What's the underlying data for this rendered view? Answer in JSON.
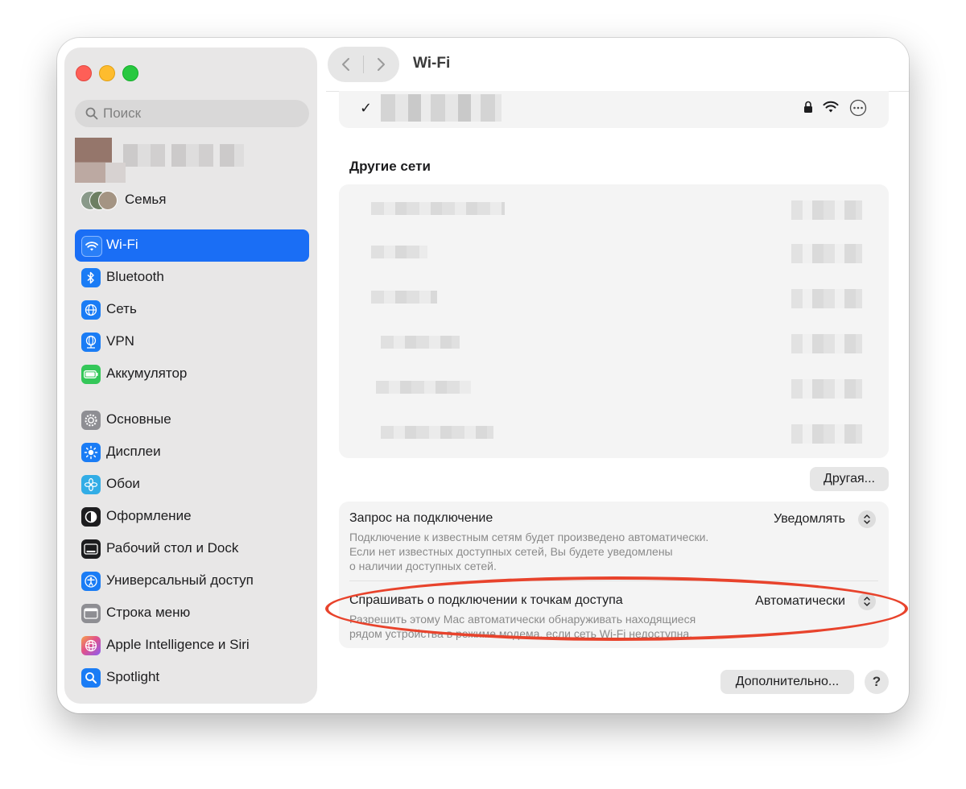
{
  "window": {
    "title": "Wi-Fi"
  },
  "search": {
    "placeholder": "Поиск"
  },
  "account": {
    "family_label": "Семья"
  },
  "sidebar": {
    "items": [
      {
        "label": "Wi-Fi",
        "icon": "wifi-icon",
        "color": "#1a6ef5",
        "active": true
      },
      {
        "label": "Bluetooth",
        "icon": "bluetooth-icon",
        "color": "#1a7cf5"
      },
      {
        "label": "Сеть",
        "icon": "globe-icon",
        "color": "#1a7cf5"
      },
      {
        "label": "VPN",
        "icon": "vpn-globe-icon",
        "color": "#1a7cf5"
      },
      {
        "label": "Аккумулятор",
        "icon": "battery-icon",
        "color": "#34c759"
      },
      {
        "label": "Основные",
        "icon": "gear-icon",
        "color": "#8e8e93"
      },
      {
        "label": "Дисплеи",
        "icon": "sun-icon",
        "color": "#1a7cf5"
      },
      {
        "label": "Обои",
        "icon": "flower-icon",
        "color": "#32ade6"
      },
      {
        "label": "Оформление",
        "icon": "appearance-icon",
        "color": "#1d1d1f"
      },
      {
        "label": "Рабочий стол и Dock",
        "icon": "dock-icon",
        "color": "#1d1d1f"
      },
      {
        "label": "Универсальный доступ",
        "icon": "accessibility-icon",
        "color": "#1a7cf5"
      },
      {
        "label": "Строка меню",
        "icon": "menubar-icon",
        "color": "#8e8e93"
      },
      {
        "label": "Apple Intelligence и Siri",
        "icon": "siri-icon",
        "color": "#c86dd7"
      },
      {
        "label": "Spotlight",
        "icon": "magnifier-icon",
        "color": "#1a7cf5"
      }
    ]
  },
  "main": {
    "current_network": {
      "check": "✓"
    },
    "other_networks_heading": "Другие сети",
    "other_button": "Другая...",
    "ask_to_join": {
      "title": "Запрос на подключение",
      "description_lines": [
        "Подключение к известным сетям будет произведено автоматически.",
        "Если нет известных доступных сетей, Вы будете уведомлены",
        "о наличии доступных сетей."
      ],
      "value": "Уведомлять"
    },
    "ask_hotspots": {
      "title": "Спрашивать о подключении к точкам доступа",
      "description_lines": [
        "Разрешить этому Mac автоматически обнаруживать находящиеся",
        "рядом устройства в режиме модема, если сеть Wi-Fi недоступна."
      ],
      "value": "Автоматически"
    },
    "advanced_button": "Дополнительно...",
    "help_button": "?"
  },
  "annotation": {
    "color": "#e8432c"
  }
}
